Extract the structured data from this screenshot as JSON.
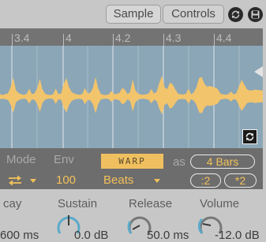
{
  "tabs": {
    "sample": "Sample",
    "controls": "Controls"
  },
  "icons": {
    "loop": "loop-arrows-icon",
    "save": "save-disk-icon",
    "follow": "follow-playhead-icon",
    "mode": "swap-arrows-icon"
  },
  "ruler": {
    "labels": [
      "3.4",
      "4",
      "4.2",
      "4.3",
      "4.4"
    ]
  },
  "warp": {
    "mode_label": "Mode",
    "env_label": "Env",
    "env_value": "100",
    "warp_button": "WARP",
    "mode_value": "Beats",
    "as_label": "as",
    "bars_value": "4 Bars",
    "half_button": ":2",
    "double_button": "*2"
  },
  "envelope": {
    "decay_label": "cay",
    "decay_value": "600 ms",
    "sustain_label": "Sustain",
    "sustain_value": "0.0 dB",
    "release_label": "Release",
    "release_value": "50.0 ms",
    "volume_label": "Volume",
    "volume_value": "-12.0 dB"
  },
  "colors": {
    "accent": "#f2c15a",
    "waveform": "#f2c46c",
    "wave_bg": "#8ba6b6",
    "panel": "#6d6d6d",
    "knob": "#5aa9c8"
  },
  "waveform_shape": [
    0.13,
    0.09,
    0.13,
    0.16,
    0.44,
    0.88,
    0.3,
    0.18,
    0.12,
    0.1,
    0.13,
    0.37,
    0.13,
    0.16,
    0.38,
    0.83,
    0.34,
    0.15,
    0.1,
    0.09,
    0.12,
    0.38,
    0.13,
    0.15,
    0.58,
    0.86,
    0.44,
    0.22,
    0.15,
    0.12,
    0.1,
    0.14,
    0.4,
    0.16,
    0.19,
    0.4,
    0.9,
    0.38,
    0.14,
    0.1,
    0.09,
    0.12,
    0.28,
    0.13,
    0.14,
    0.19,
    0.4,
    0.34,
    0.13,
    0.22,
    0.8,
    0.3,
    0.15,
    0.11,
    0.1,
    0.12,
    0.16,
    0.36,
    0.15,
    0.23,
    0.64,
    0.96,
    0.44,
    0.35,
    0.65,
    0.57,
    0.35,
    0.15,
    0.12,
    0.11,
    0.14,
    0.38,
    0.12,
    0.21,
    0.44,
    0.86,
    0.9,
    0.6,
    0.46,
    0.5,
    0.46,
    0.43,
    0.36,
    0.15,
    0.12,
    0.1,
    0.13,
    0.25,
    0.12,
    0.16,
    0.48,
    0.78,
    0.56,
    0.35,
    0.29,
    0.3,
    0.33,
    0.32,
    0.3,
    0.3
  ]
}
